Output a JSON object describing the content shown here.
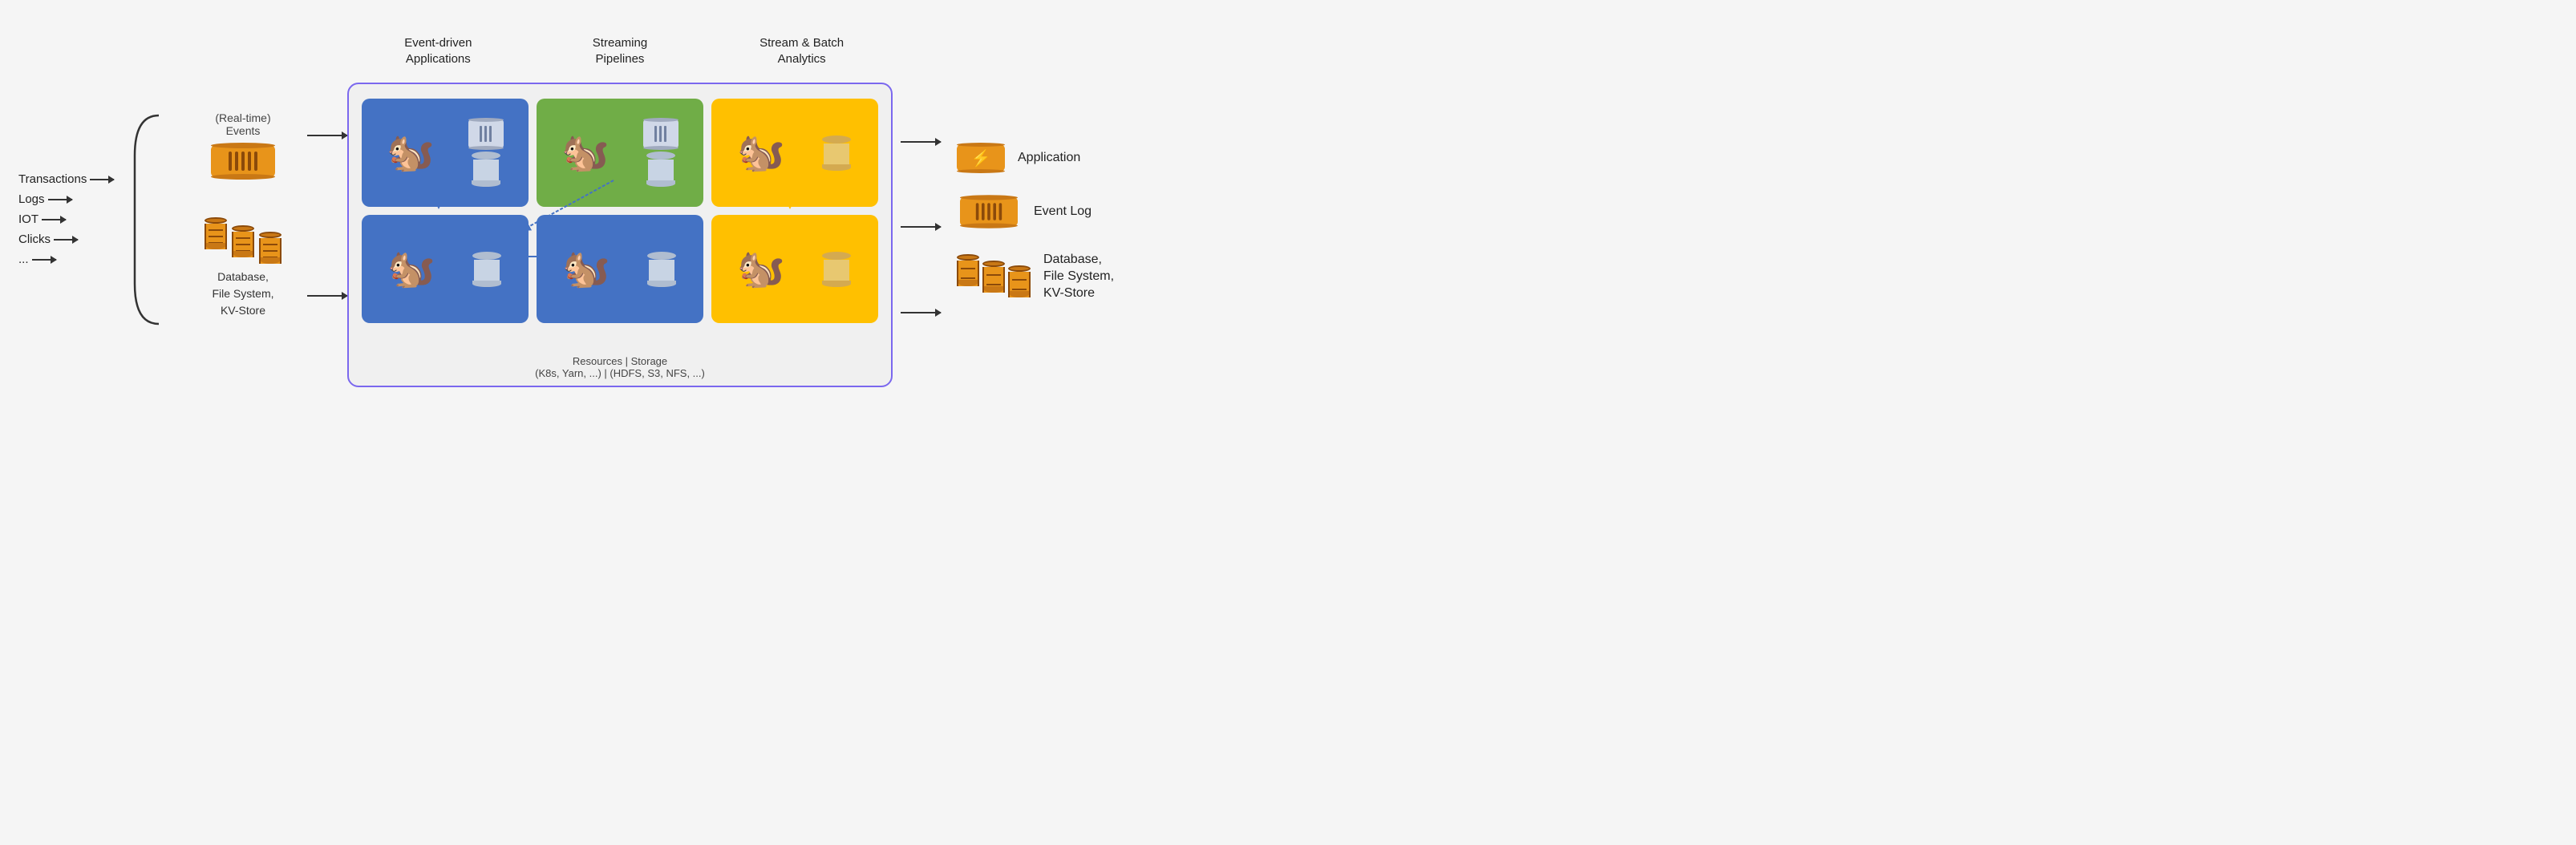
{
  "headers": {
    "col1": "Event-driven\nApplications",
    "col2": "Streaming\nPipelines",
    "col3": "Stream & Batch\nAnalytics"
  },
  "left_inputs": {
    "items": [
      "Transactions",
      "Logs",
      "IOT",
      "Clicks",
      "..."
    ]
  },
  "labels": {
    "realtime_events": "(Real-time)\nEvents",
    "database_label": "Database,\nFile System,\nKV-Store",
    "resources_storage": "Resources | Storage\n(K8s, Yarn, ...) | (HDFS, S3, NFS, ...)"
  },
  "right_labels": {
    "application": "Application",
    "event_log": "Event Log",
    "database": "Database,\nFile System,\nKV-Store"
  }
}
